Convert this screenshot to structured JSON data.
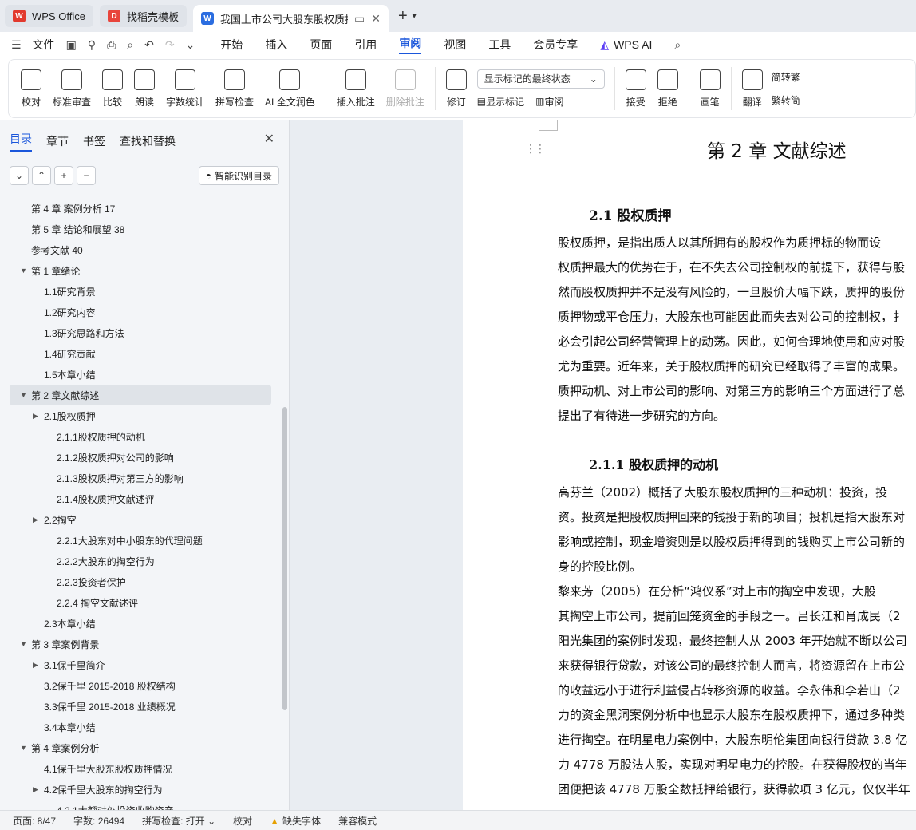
{
  "tabs": [
    {
      "label": "WPS Office",
      "icon": "wps-logo-icon",
      "color": "#e23a2e"
    },
    {
      "label": "找稻壳模板",
      "icon": "docer-icon",
      "color": "#e8453c"
    },
    {
      "label": "我国上市公司大股东股权质押",
      "icon": "word-doc-icon",
      "color": "#2b6de0",
      "active": true
    }
  ],
  "menu": {
    "file": "文件",
    "items": [
      "开始",
      "插入",
      "页面",
      "引用",
      "审阅",
      "视图",
      "工具",
      "会员专享",
      "WPS AI"
    ],
    "active": "审阅"
  },
  "ribbon": {
    "group1": [
      "校对",
      "标准审查",
      "比较",
      "朗读",
      "字数统计",
      "拼写检查",
      "AI 全文润色"
    ],
    "group2": [
      "插入批注",
      "删除批注"
    ],
    "revise": "修订",
    "display_select": "显示标记的最终状态",
    "show_marks": "显示标记",
    "review": "审阅",
    "accept": "接受",
    "reject": "拒绝",
    "pen": "画笔",
    "translate": "翻译",
    "to_trad": "简转繁",
    "to_simp": "繁转简"
  },
  "nav": {
    "tabs": [
      "目录",
      "章节",
      "书签",
      "查找和替换"
    ],
    "active": "目录",
    "smart": "智能识别目录"
  },
  "toc": [
    {
      "t": "第 4 章  案例分析  17",
      "l": 1,
      "a": ""
    },
    {
      "t": "第 5 章  结论和展望  38",
      "l": 1,
      "a": ""
    },
    {
      "t": "参考文献  40",
      "l": 1,
      "a": ""
    },
    {
      "t": "第 1 章绪论",
      "l": 1,
      "a": "down"
    },
    {
      "t": "1.1研究背景",
      "l": 2,
      "a": ""
    },
    {
      "t": "1.2研究内容",
      "l": 2,
      "a": ""
    },
    {
      "t": "1.3研究思路和方法",
      "l": 2,
      "a": ""
    },
    {
      "t": "1.4研究贡献",
      "l": 2,
      "a": ""
    },
    {
      "t": "1.5本章小结",
      "l": 2,
      "a": ""
    },
    {
      "t": "第 2 章文献综述",
      "l": 1,
      "a": "down",
      "sel": true
    },
    {
      "t": "2.1股权质押",
      "l": 2,
      "a": "right"
    },
    {
      "t": "2.1.1股权质押的动机",
      "l": 3,
      "a": ""
    },
    {
      "t": "2.1.2股权质押对公司的影响",
      "l": 3,
      "a": ""
    },
    {
      "t": "2.1.3股权质押对第三方的影响",
      "l": 3,
      "a": ""
    },
    {
      "t": "2.1.4股权质押文献述评",
      "l": 3,
      "a": ""
    },
    {
      "t": "2.2掏空",
      "l": 2,
      "a": "right"
    },
    {
      "t": "2.2.1大股东对中小股东的代理问题",
      "l": 3,
      "a": ""
    },
    {
      "t": "2.2.2大股东的掏空行为",
      "l": 3,
      "a": ""
    },
    {
      "t": "2.2.3投资者保护",
      "l": 3,
      "a": ""
    },
    {
      "t": "2.2.4    掏空文献述评",
      "l": 3,
      "a": ""
    },
    {
      "t": "2.3本章小结",
      "l": 2,
      "a": ""
    },
    {
      "t": "第 3 章案例背景",
      "l": 1,
      "a": "down"
    },
    {
      "t": "3.1保千里简介",
      "l": 2,
      "a": "right"
    },
    {
      "t": "3.2保千里 2015-2018 股权结构",
      "l": 2,
      "a": ""
    },
    {
      "t": "3.3保千里 2015-2018 业绩概况",
      "l": 2,
      "a": ""
    },
    {
      "t": "3.4本章小结",
      "l": 2,
      "a": ""
    },
    {
      "t": "第 4 章案例分析",
      "l": 1,
      "a": "down"
    },
    {
      "t": "4.1保千里大股东股权质押情况",
      "l": 2,
      "a": ""
    },
    {
      "t": "4.2保千里大股东的掏空行为",
      "l": 2,
      "a": "right"
    },
    {
      "t": "4.2.1大额对外投资收购资产",
      "l": 3,
      "a": ""
    }
  ],
  "doc": {
    "chapter": "第 2 章  文献综述",
    "s21": "2.1  股权质押",
    "p1": [
      "    股权质押，是指出质人以其所拥有的股权作为质押标的物而设",
      "权质押最大的优势在于，在不失去公司控制权的前提下，获得与股",
      "然而股权质押并不是没有风险的，一旦股价大幅下跌，质押的股份",
      "质押物或平仓压力，大股东也可能因此而失去对公司的控制权，扌",
      "必会引起公司经营管理上的动荡。因此，如何合理地使用和应对股",
      "尤为重要。近年来，关于股权质押的研究已经取得了丰富的成果。",
      "质押动机、对上市公司的影响、对第三方的影响三个方面进行了总",
      "提出了有待进一步研究的方向。"
    ],
    "s211": "2.1.1  股权质押的动机",
    "p2": [
      "    高芬兰（2002）概括了大股东股权质押的三种动机：投资，投",
      "资。投资是把股权质押回来的钱投于新的项目；投机是指大股东对",
      "影响或控制，现金增资则是以股权质押得到的钱购买上市公司新的",
      "身的控股比例。",
      "    黎来芳（2005）在分析“鸿仪系”对上市的掏空中发现，大股",
      "其掏空上市公司，提前回笼资金的手段之一。吕长江和肖成民（2",
      "阳光集团的案例时发现，最终控制人从 2003 年开始就不断以公司",
      "来获得银行贷款，对该公司的最终控制人而言，将资源留在上市公",
      "的收益远小于进行利益侵占转移资源的收益。李永伟和李若山（2",
      "力的资金黑洞案例分析中也显示大股东在股权质押下，通过多种类",
      "进行掏空。在明星电力案例中，大股东明伦集团向银行贷款 3.8 亿",
      "力 4778 万股法人股，实现对明星电力的控股。在获得股权的当年",
      "团便把该 4778 万股全数抵押给银行，获得款项 3 亿元，仅仅半年"
    ]
  },
  "status": {
    "page": "页面: 8/47",
    "words": "字数: 26494",
    "spell": "拼写检查: 打开",
    "proof": "校对",
    "font": "缺失字体",
    "compat": "兼容模式"
  }
}
